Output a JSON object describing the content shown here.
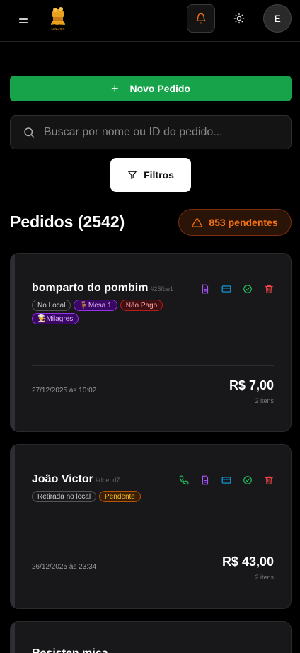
{
  "header": {
    "logo_text": "EDIENAI",
    "logo_sub": "LANCHES",
    "icons": {
      "menu": "menu-icon",
      "bell": "bell-icon",
      "theme": "sun-icon"
    },
    "avatar_initial": "E"
  },
  "actions": {
    "new_order_label": "Novo Pedido",
    "search_placeholder": "Buscar por nome ou ID do pedido...",
    "filters_label": "Filtros"
  },
  "orders": {
    "title": "Pedidos (2542)",
    "pending_label": "853 pendentes",
    "list": [
      {
        "name": "bomparto do pombim",
        "id": "#25fbe1",
        "badges": [
          "No Local",
          "🪑Mesa 1",
          "Não Pago",
          "👨‍🍳Milagres"
        ],
        "date": "27/12/2025 às 10:02",
        "total": "R$ 7,00",
        "items": "2 itens"
      },
      {
        "name": "João Victor",
        "id": "#dcebd7",
        "badges": [
          "Retirada no local",
          "Pendente"
        ],
        "date": "26/12/2025 às 23:34",
        "total": "R$ 43,00",
        "items": "2 itens"
      },
      {
        "name": "Resisten mica"
      }
    ]
  },
  "colors": {
    "primary_green": "#16a34a",
    "pending_orange": "#f97316",
    "bell_orange": "#f97316",
    "card_bg": "#18181b"
  }
}
